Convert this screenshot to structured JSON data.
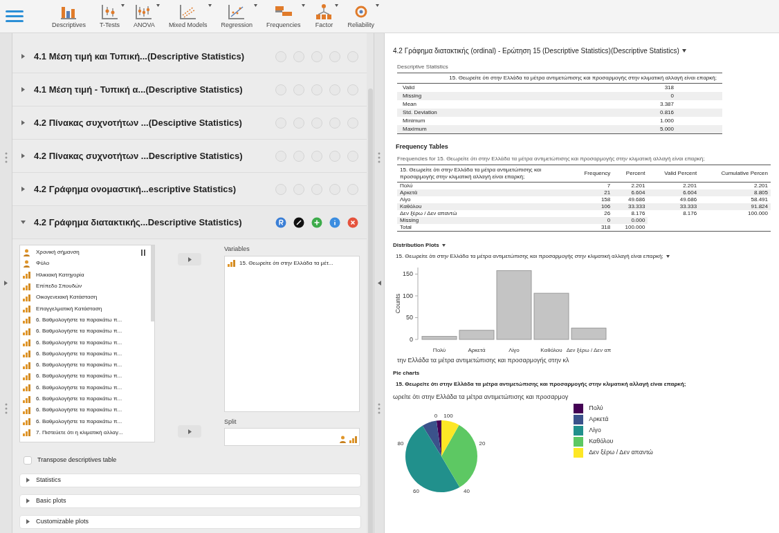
{
  "toolbar": {
    "modules": [
      {
        "label": "Descriptives",
        "has_dropdown": false
      },
      {
        "label": "T-Tests",
        "has_dropdown": true
      },
      {
        "label": "ANOVA",
        "has_dropdown": true
      },
      {
        "label": "Mixed Models",
        "has_dropdown": true
      },
      {
        "label": "Regression",
        "has_dropdown": true
      },
      {
        "label": "Frequencies",
        "has_dropdown": true
      },
      {
        "label": "Factor",
        "has_dropdown": true
      },
      {
        "label": "Reliability",
        "has_dropdown": true
      }
    ]
  },
  "analyses": [
    {
      "title": "4.1 Μέση τιμή και Τυπική...(Descriptive Statistics)",
      "expanded": false
    },
    {
      "title": "4.1 Μέση τιμή - Τυπική α...(Descriptive Statistics)",
      "expanded": false
    },
    {
      "title": "4.2 Πίνακας συχνοτήτων ...(Desciptive Statistics)",
      "expanded": false
    },
    {
      "title": "4.2 Πίνακας συχνοτήτων ...Descriptive Statistics)",
      "expanded": false
    },
    {
      "title": "4.2 Γράφημα ονομαστική...escriptive Statistics)",
      "expanded": false
    },
    {
      "title": "4.2 Γράφημα διατακτικής...Descriptive Statistics)",
      "expanded": true
    }
  ],
  "form": {
    "source_variables": [
      {
        "name": "Χρονική σήμανση",
        "kind": "nominal"
      },
      {
        "name": "Φύλο",
        "kind": "nominal"
      },
      {
        "name": "Ηλικιακή Κατηγορία",
        "kind": "ordinal"
      },
      {
        "name": "Επίπεδο Σπουδών",
        "kind": "ordinal"
      },
      {
        "name": "Οικογενειακή Κατάσταση",
        "kind": "ordinal"
      },
      {
        "name": "Επαγγελματική Κατάσταση",
        "kind": "ordinal"
      },
      {
        "name": "6. Βαθμολογήστε τα παρακάτω π...",
        "kind": "ordinal"
      },
      {
        "name": "6. Βαθμολογήστε τα παρακάτω π...",
        "kind": "ordinal"
      },
      {
        "name": "6. Βαθμολογήστε τα παρακάτω π...",
        "kind": "ordinal"
      },
      {
        "name": "6. Βαθμολογήστε τα παρακάτω π...",
        "kind": "ordinal"
      },
      {
        "name": "6. Βαθμολογήστε τα παρακάτω π...",
        "kind": "ordinal"
      },
      {
        "name": "6. Βαθμολογήστε τα παρακάτω π...",
        "kind": "ordinal"
      },
      {
        "name": "6. Βαθμολογήστε τα παρακάτω π...",
        "kind": "ordinal"
      },
      {
        "name": "6. Βαθμολογήστε τα παρακάτω π...",
        "kind": "ordinal"
      },
      {
        "name": "6. Βαθμολογήστε τα παρακάτω π...",
        "kind": "ordinal"
      },
      {
        "name": "6. Βαθμολογήστε τα παρακάτω π...",
        "kind": "ordinal"
      },
      {
        "name": "7. Πιστεύετε ότι η κλιματική αλλαγ...",
        "kind": "ordinal"
      }
    ],
    "variables_label": "Variables",
    "variables": [
      {
        "name": "15. Θεωρείτε ότι στην Ελλάδα τα μέτ...",
        "kind": "ordinal"
      }
    ],
    "split_label": "Split",
    "transpose": {
      "label": "Transpose descriptives table",
      "checked": false
    },
    "sections": [
      {
        "label": "Statistics",
        "expanded": false
      },
      {
        "label": "Basic plots",
        "expanded": false
      },
      {
        "label": "Customizable plots",
        "expanded": false
      }
    ]
  },
  "output": {
    "title": "4.2 Γράφημα διατακτικής (ordinal) - Ερώτηση 15 (Descriptive Statistics)(Descriptive Statistics)",
    "descriptives": {
      "caption": "Descriptive Statistics",
      "column": "15. Θεωρείτε ότι στην Ελλάδα τα μέτρα αντιμετώπισης και προσαρμογής στην κλιματική αλλαγή είναι επαρκή;",
      "rows": [
        {
          "label": "Valid",
          "value": "318"
        },
        {
          "label": "Missing",
          "value": "0"
        },
        {
          "label": "Mean",
          "value": "3.387"
        },
        {
          "label": "Std. Deviation",
          "value": "0.816"
        },
        {
          "label": "Minimum",
          "value": "1.000"
        },
        {
          "label": "Maximum",
          "value": "5.000"
        }
      ]
    },
    "frequency_heading": "Frequency Tables",
    "frequency_table": {
      "caption": "Frequencies for 15. Θεωρείτε ότι στην Ελλάδα τα μέτρα αντιμετώπισης και προσαρμογής στην κλιματική αλλαγή είναι επαρκή;",
      "columns": [
        "15. Θεωρείτε ότι στην Ελλάδα τα μέτρα αντιμετώπισης και προσαρμογής στην κλιματική αλλαγή είναι επαρκή;",
        "Frequency",
        "Percent",
        "Valid Percent",
        "Cumulative Percen"
      ],
      "rows": [
        [
          "Πολύ",
          "7",
          "2.201",
          "2.201",
          "2.201"
        ],
        [
          "Αρκετά",
          "21",
          "6.604",
          "6.604",
          "8.805"
        ],
        [
          "Λίγο",
          "158",
          "49.686",
          "49.686",
          "58.491"
        ],
        [
          "Καθόλου",
          "106",
          "33.333",
          "33.333",
          "91.824"
        ],
        [
          "Δεν ξέρω / Δεν απαντώ",
          "26",
          "8.176",
          "8.176",
          "100.000"
        ],
        [
          "Missing",
          "0",
          "0.000"
        ],
        [
          "Total",
          "318",
          "100.000"
        ]
      ]
    },
    "distribution_heading": "Distribution Plots",
    "distribution_plot": {
      "title": "15. Θεωρείτε ότι στην Ελλάδα τα μέτρα αντιμετώπισης και προσαρμογής στην κλιματική αλλαγή είναι επαρκή;",
      "chart_data": {
        "type": "bar",
        "xlabel": "την Ελλάδα τα μέτρα αντιμετώπισης και προσαρμογής στην κλ",
        "ylabel": "Counts",
        "categories": [
          "Πολύ",
          "Αρκετά",
          "Λίγο",
          "Καθόλου",
          "Δεν ξέρω / Δεν απ"
        ],
        "values": [
          7,
          21,
          158,
          106,
          26
        ],
        "ylim": [
          0,
          165
        ],
        "yticks": [
          0,
          50,
          100,
          150
        ]
      }
    },
    "pie_heading": "Pie charts",
    "pie_plot": {
      "title": "15. Θεωρείτε ότι στην Ελλάδα τα μέτρα αντιμετώπισης και προσαρμογής στην κλιματική αλλαγή είναι επαρκή;",
      "chart_data": {
        "type": "pie",
        "title": "ωρείτε ότι στην Ελλάδα τα μέτρα αντιμετώπισης και προσαρμογ",
        "categories": [
          "Πολύ",
          "Αρκετά",
          "Λίγο",
          "Καθόλου",
          "Δεν ξέρω / Δεν απαντώ"
        ],
        "values": [
          2.201,
          6.604,
          49.686,
          33.333,
          8.176
        ],
        "colors": [
          "#440154",
          "#3b528b",
          "#21908c",
          "#5dc863",
          "#fde725"
        ],
        "legend": "right"
      },
      "angle_labels": [
        "0",
        "20",
        "40",
        "60",
        "80",
        "100"
      ]
    }
  }
}
